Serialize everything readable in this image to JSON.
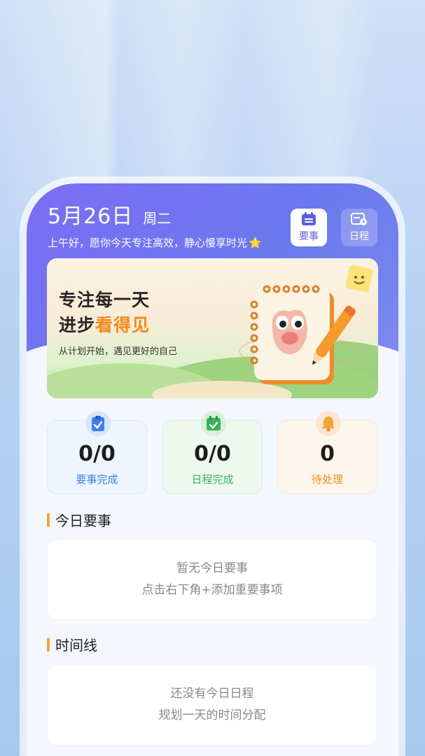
{
  "header": {
    "date": "5月26日",
    "weekday": "周二",
    "greeting": "上午好，愿你今天专注高效，静心慢享时光",
    "greeting_emoji": "⭐",
    "btn_important": "要事",
    "btn_schedule": "日程"
  },
  "banner": {
    "line1": "专注每一天",
    "line2_prefix": "进步",
    "line2_highlight": "看得见",
    "subtitle": "从计划开始，遇见更好的自己"
  },
  "stats": [
    {
      "value": "0/0",
      "label": "要事完成",
      "icon": "clipboard-check-icon",
      "color": "#3a7ff0"
    },
    {
      "value": "0/0",
      "label": "日程完成",
      "icon": "calendar-check-icon",
      "color": "#3bb15a"
    },
    {
      "value": "0",
      "label": "待处理",
      "icon": "bell-icon",
      "color": "#f08a1a"
    }
  ],
  "sections": {
    "important": {
      "title": "今日要事",
      "empty_line1": "暂无今日要事",
      "empty_line2": "点击右下角+添加重要事项"
    },
    "timeline": {
      "title": "时间线",
      "empty_line1": "还没有今日日程",
      "empty_line2": "规划一天的时间分配"
    }
  },
  "colors": {
    "header_start": "#7c6ef5",
    "header_end": "#7e8bef",
    "accent_orange": "#f28a1b",
    "section_bar": "#f5a43a"
  }
}
